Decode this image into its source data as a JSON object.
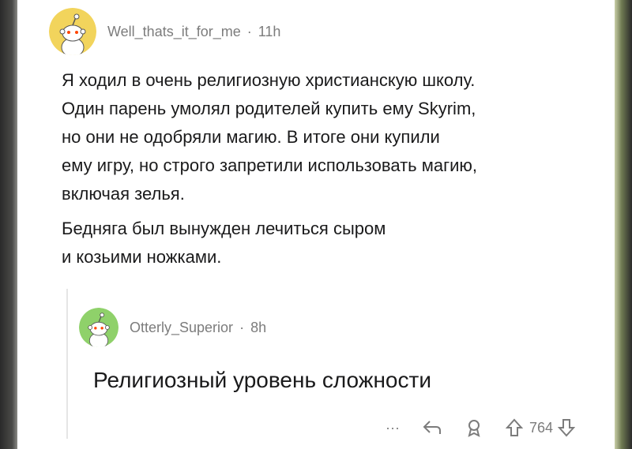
{
  "comments": [
    {
      "username": "Well_thats_it_for_me",
      "separator": "·",
      "time": "11h",
      "avatar_color": "#f2d45c",
      "paragraphs": [
        "Я ходил в очень религиозную христианскую школу.",
        "Один парень умолял родителей купить ему Skyrim,",
        "но они не одобряли магию. В итоге они купили",
        "ему игру, но строго запретили использовать магию,",
        "включая зелья."
      ],
      "paragraph2": [
        "Бедняга был вынужден лечиться сыром",
        "и козьими ножками."
      ]
    },
    {
      "username": "Otterly_Superior",
      "separator": "·",
      "time": "8h",
      "avatar_color": "#8fd16a",
      "text": "Религиозный уровень сложности"
    }
  ],
  "actions": {
    "more": "···",
    "reply_icon": "reply-icon",
    "award_icon": "award-icon",
    "upvote_icon": "upvote-icon",
    "vote_count": "764",
    "downvote_icon": "downvote-icon"
  }
}
